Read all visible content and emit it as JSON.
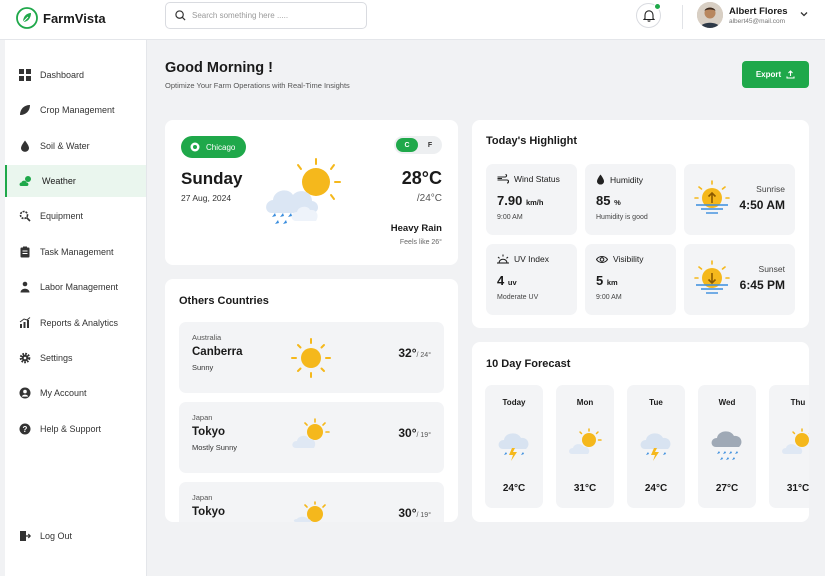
{
  "app": {
    "brand": "FarmVista"
  },
  "search": {
    "placeholder": "Search something here ....."
  },
  "user": {
    "name": "Albert Flores",
    "email": "albert45@mail.com"
  },
  "nav": [
    {
      "label": "Dashboard",
      "icon": "grid-icon"
    },
    {
      "label": "Crop Management",
      "icon": "leaf-icon"
    },
    {
      "label": "Soil & Water",
      "icon": "drop-icon"
    },
    {
      "label": "Weather",
      "icon": "cloud-sun-icon"
    },
    {
      "label": "Equipment",
      "icon": "gear-search-icon"
    },
    {
      "label": "Task Management",
      "icon": "clipboard-icon"
    },
    {
      "label": "Labor Management",
      "icon": "people-icon"
    },
    {
      "label": "Reports & Analytics",
      "icon": "chart-icon"
    },
    {
      "label": "Settings",
      "icon": "gear-icon"
    },
    {
      "label": "My Account",
      "icon": "user-icon"
    },
    {
      "label": "Help & Support",
      "icon": "help-icon"
    }
  ],
  "logout": {
    "label": "Log Out"
  },
  "header": {
    "greeting": "Good Morning !",
    "subtitle": "Optimize Your Farm Operations with Real-Time Insights",
    "export": "Export"
  },
  "today": {
    "location": "Chicago",
    "unit_c": "C",
    "unit_f": "F",
    "day": "Sunday",
    "date": "27 Aug, 2024",
    "temp": "28°C",
    "low": "/24°C",
    "condition": "Heavy Rain",
    "feels": "Feels like 26°"
  },
  "countries": {
    "title": "Others Countries",
    "items": [
      {
        "country": "Australia",
        "city": "Canberra",
        "desc": "Sunny",
        "temp": "32°",
        "low": "/ 24°",
        "icon": "sun-icon"
      },
      {
        "country": "Japan",
        "city": "Tokyo",
        "desc": "Mostly Sunny",
        "temp": "30°",
        "low": "/ 19°",
        "icon": "partly-sunny-icon"
      },
      {
        "country": "Japan",
        "city": "Tokyo",
        "desc": "",
        "temp": "30°",
        "low": "/ 19°",
        "icon": "partly-sunny-icon"
      }
    ]
  },
  "highlight": {
    "title": "Today's Highlight",
    "wind": {
      "label": "Wind Status",
      "value": "7.90",
      "unit": "km/h",
      "sub": "9:00 AM"
    },
    "humidity": {
      "label": "Humidity",
      "value": "85",
      "unit": "%",
      "sub": "Humidity is good"
    },
    "uv": {
      "label": "UV Index",
      "value": "4",
      "unit": "uv",
      "sub": "Moderate UV"
    },
    "visibility": {
      "label": "Visibility",
      "value": "5",
      "unit": "km",
      "sub": "9:00 AM"
    },
    "sunrise": {
      "label": "Sunrise",
      "value": "4:50 AM"
    },
    "sunset": {
      "label": "Sunset",
      "value": "6:45 PM"
    }
  },
  "forecast": {
    "title": "10 Day Forecast",
    "days": [
      {
        "day": "Today",
        "temp": "24°C",
        "icon": "storm-icon"
      },
      {
        "day": "Mon",
        "temp": "31°C",
        "icon": "partly-sunny-icon"
      },
      {
        "day": "Tue",
        "temp": "24°C",
        "icon": "storm-icon"
      },
      {
        "day": "Wed",
        "temp": "27°C",
        "icon": "heavy-rain-icon"
      },
      {
        "day": "Thu",
        "temp": "31°C",
        "icon": "partly-sunny-icon"
      }
    ]
  },
  "colors": {
    "accent": "#1fa84a",
    "sun": "#f5b81c",
    "cloud": "#d8e4f3",
    "rain": "#3a8dde"
  }
}
